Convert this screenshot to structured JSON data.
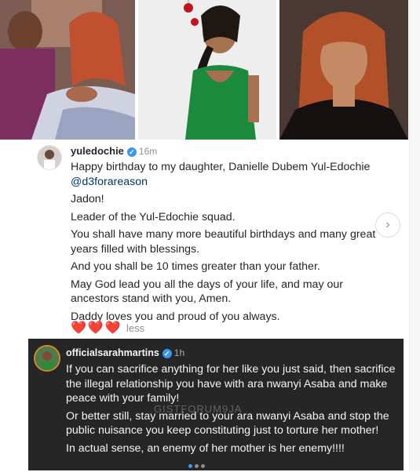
{
  "post": {
    "username": "yuledochie",
    "verified_mark": "✓",
    "time": "16m",
    "caption_line1_prefix": "Happy birthday to my daughter, Danielle Dubem Yul-Edochie ",
    "mention": "@d3forareason",
    "lines": [
      "Jadon!",
      "Leader of the Yul-Edochie squad.",
      "You shall have many more beautiful birthdays and many great years filled with blessings.",
      "And you shall be 10 times greater than your father.",
      "May God lead you all the days of your life, and may our ancestors stand with you, Amen.",
      "Daddy loves you and proud of you always."
    ],
    "hearts": "❤️❤️❤️",
    "less_label": "less",
    "next_icon": "›"
  },
  "comment": {
    "username": "officialsarahmartins",
    "verified_mark": "✓",
    "time": "1h",
    "lines": [
      "If you can sacrifice anything for her like you just said, then sacrifice the illegal relationship you have with ara nwanyi Asaba and make peace with your family!",
      "Or better still, stay married to your ara nwanyi Asaba and stop the public nuisance you keep constituting just to torture her mother!",
      "In actual sense, an enemy of her mother is her enemy!!!!"
    ]
  },
  "watermark": "GISTFORUM9JA",
  "colors": {
    "verified_blue": "#3897f0",
    "mention_blue": "#00376b",
    "comment_bg": "#262626",
    "heart_red": "#e0245e"
  }
}
